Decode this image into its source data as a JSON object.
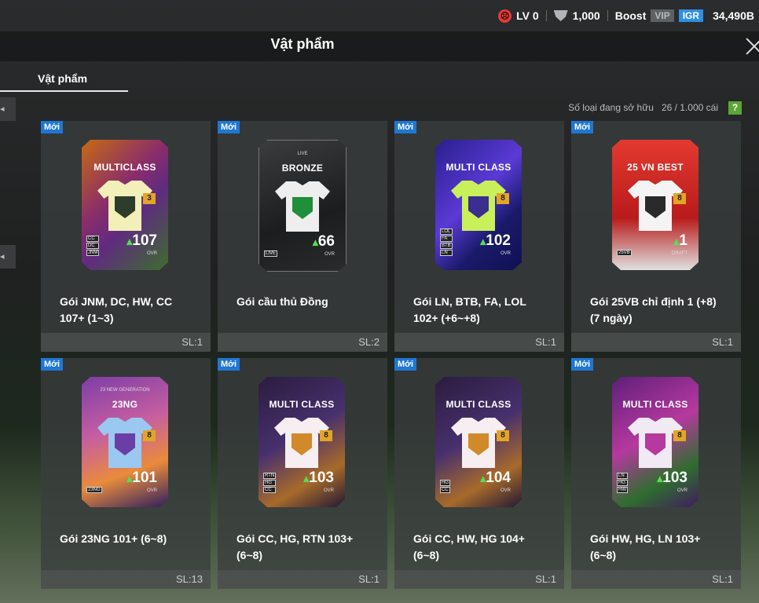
{
  "status": {
    "level": "LV 0",
    "coins": "1,000",
    "boost": "Boost",
    "vip": "VIP",
    "igr": "IGR",
    "balance": "34,490B"
  },
  "header": {
    "title": "Vật phẩm"
  },
  "tabs": [
    {
      "label": "Vật phẩm"
    }
  ],
  "summary": {
    "label": "Số loại đang sở hữu",
    "count": "26 / 1.000 cái",
    "help": "?"
  },
  "items": [
    {
      "badge": "Mới",
      "name_line1": "Gói JNM, DC, HW, CC",
      "name_line2": "107+ (1~3)",
      "qty": "SL:1",
      "card": {
        "title": "MULTICLASS",
        "sub": "",
        "level": "3",
        "ovr": "107",
        "ovr_label": "OVR",
        "tags": [
          "CC",
          "DC",
          "JNM"
        ]
      }
    },
    {
      "badge": "Mới",
      "name_line1": "Gói cầu thủ Đồng",
      "name_line2": "",
      "qty": "SL:2",
      "card": {
        "title": "BRONZE",
        "sub": "LIVE",
        "level": "",
        "ovr": "66",
        "ovr_label": "OVR",
        "tags": [
          "LIVE"
        ]
      }
    },
    {
      "badge": "Mới",
      "name_line1": "Gói LN, BTB, FA, LOL",
      "name_line2": "102+ (+6~+8)",
      "qty": "SL:1",
      "card": {
        "title": "MULTI CLASS",
        "sub": "",
        "level": "8",
        "ovr": "102",
        "ovr_label": "OVR",
        "tags": [
          "LOL",
          "FA",
          "BTB",
          "LN"
        ]
      }
    },
    {
      "badge": "Mới",
      "name_line1": "Gói 25VB chỉ định 1 (+8)",
      "name_line2": "(7 ngày)",
      "qty": "SL:1",
      "card": {
        "title": "25 VN BEST",
        "sub": "",
        "level": "8",
        "ovr": "1",
        "ovr_label": "DRAFT",
        "tags": [
          "25VB"
        ]
      }
    },
    {
      "badge": "Mới",
      "name_line1": "Gói 23NG 101+ (6~8)",
      "name_line2": "",
      "qty": "SL:13",
      "card": {
        "title": "23NG",
        "sub": "23 NEW GENERATION",
        "level": "8",
        "ovr": "101",
        "ovr_label": "OVR",
        "tags": [
          "23NG"
        ]
      }
    },
    {
      "badge": "Mới",
      "name_line1": "Gói CC, HG, RTN 103+",
      "name_line2": "(6~8)",
      "qty": "SL:1",
      "card": {
        "title": "MULTI CLASS",
        "sub": "",
        "level": "8",
        "ovr": "103",
        "ovr_label": "OVR",
        "tags": [
          "RTN",
          "HG",
          "CC"
        ]
      }
    },
    {
      "badge": "Mới",
      "name_line1": "Gói CC, HW, HG 104+",
      "name_line2": "(6~8)",
      "qty": "SL:1",
      "card": {
        "title": "MULTI CLASS",
        "sub": "",
        "level": "8",
        "ovr": "104",
        "ovr_label": "OVR",
        "tags": [
          "HG",
          "CC"
        ]
      }
    },
    {
      "badge": "Mới",
      "name_line1": "Gói HW, HG, LN 103+",
      "name_line2": "(6~8)",
      "qty": "SL:1",
      "card": {
        "title": "MULTI CLASS",
        "sub": "",
        "level": "8",
        "ovr": "103",
        "ovr_label": "OVR",
        "tags": [
          "LN",
          "HG",
          "HW"
        ]
      }
    }
  ]
}
